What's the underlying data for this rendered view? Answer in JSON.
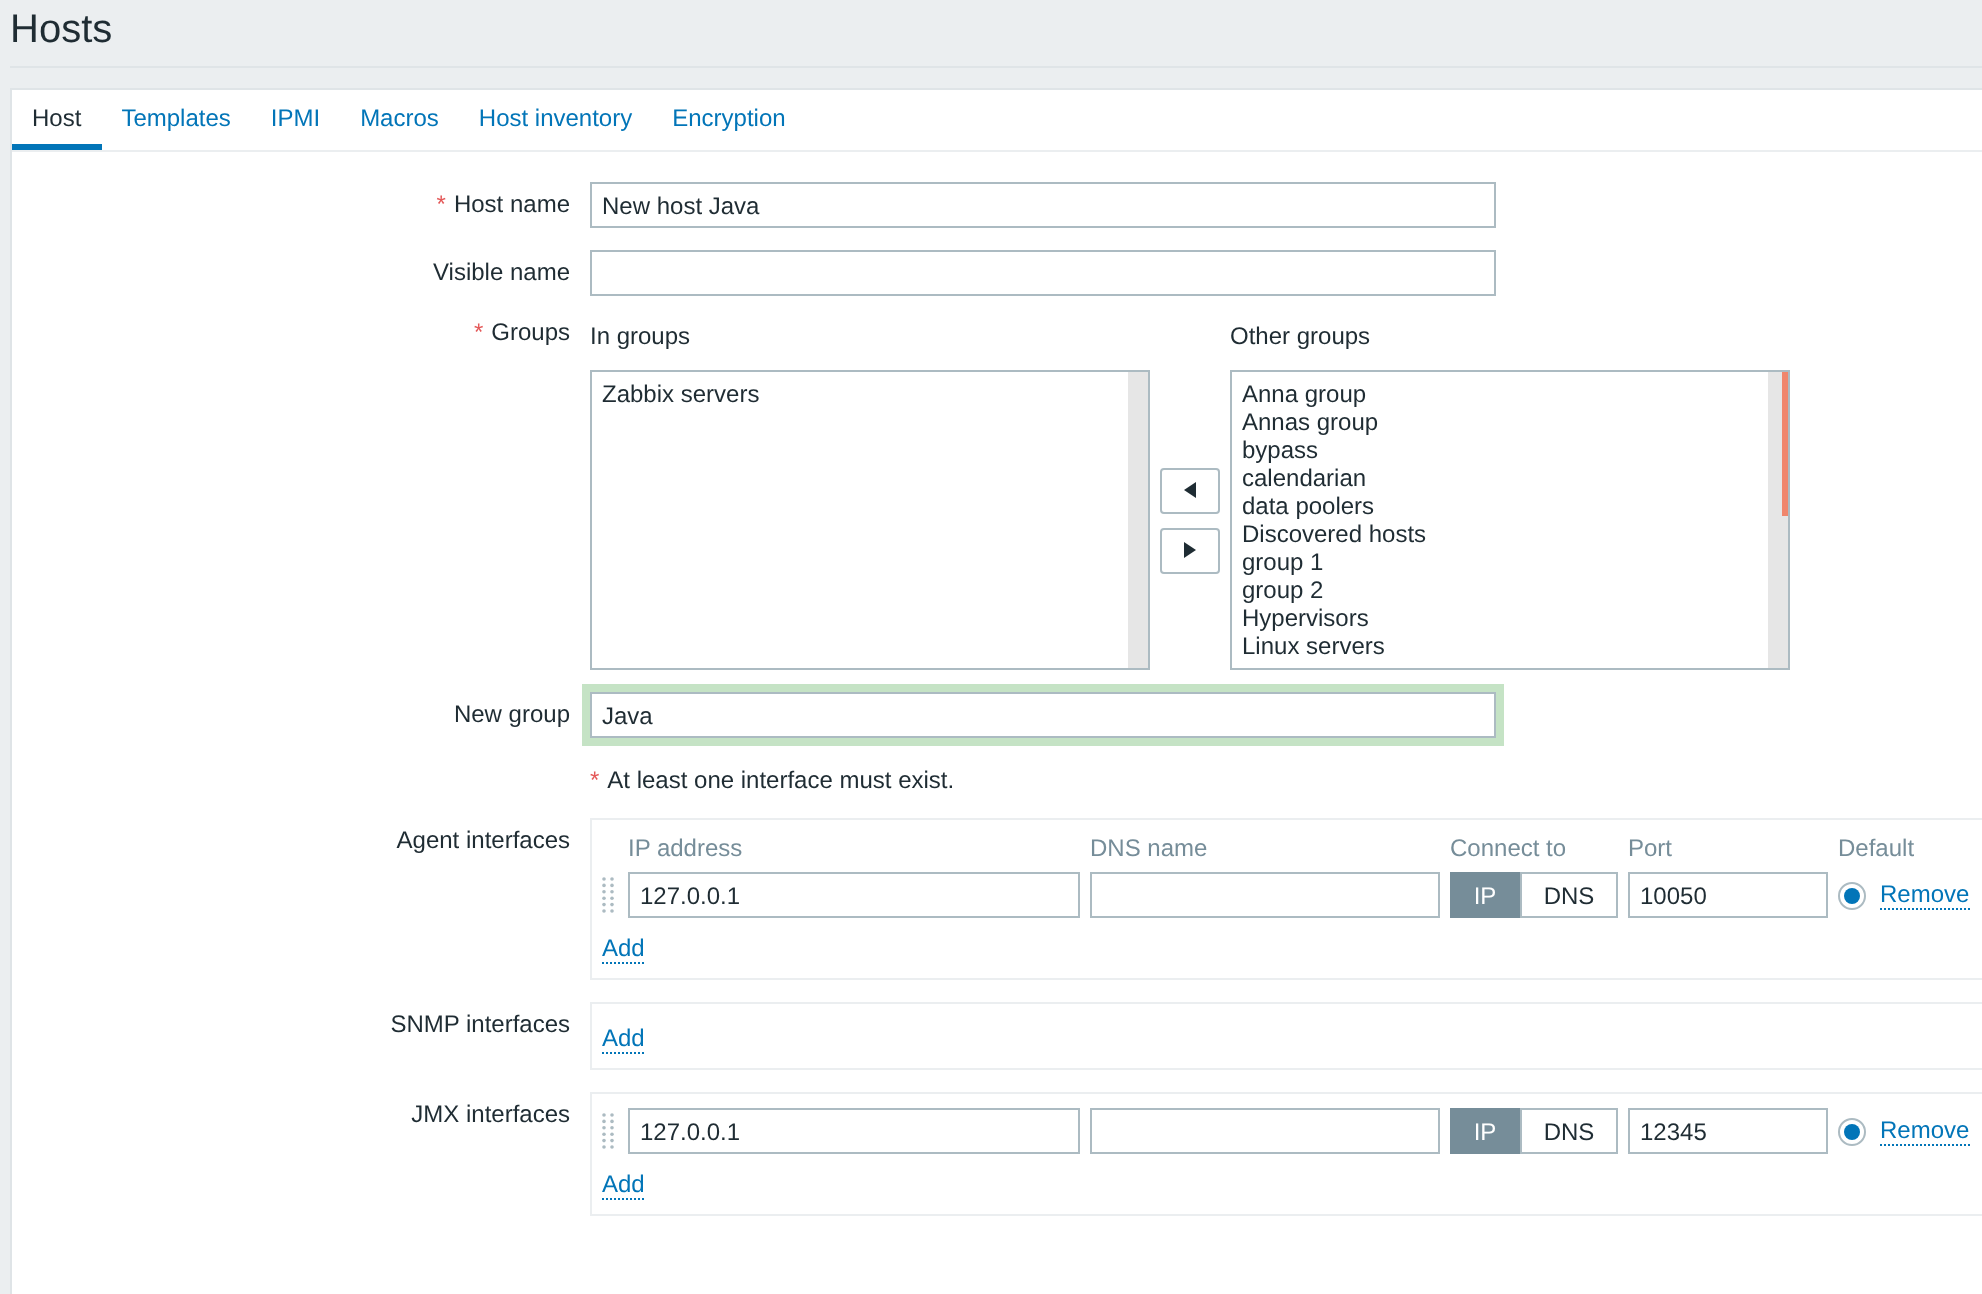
{
  "page_title": "Hosts",
  "tabs": [
    {
      "label": "Host",
      "selected": true
    },
    {
      "label": "Templates",
      "selected": false
    },
    {
      "label": "IPMI",
      "selected": false
    },
    {
      "label": "Macros",
      "selected": false
    },
    {
      "label": "Host inventory",
      "selected": false
    },
    {
      "label": "Encryption",
      "selected": false
    }
  ],
  "required_mark": "*",
  "host_name": {
    "label": "Host name",
    "required": true,
    "value": "New host Java"
  },
  "visible_name": {
    "label": "Visible name",
    "required": false
  },
  "groups": {
    "label": "Groups",
    "required": true,
    "in_groups": {
      "heading": "In groups",
      "items": [
        "Zabbix servers"
      ]
    },
    "other_groups": {
      "heading": "Other groups",
      "items": [
        "Anna group",
        "Annas group",
        "bypass",
        "calendarian",
        "data poolers",
        "Discovered hosts",
        "group 1",
        "group 2",
        "Hypervisors",
        "Linux servers"
      ]
    }
  },
  "new_group": {
    "label": "New group",
    "value": "Java"
  },
  "interface_note": "At least one interface must exist.",
  "interfaces": [
    {
      "label": "Agent interfaces",
      "columns": [
        "IP address",
        "DNS name",
        "Connect to",
        "Port",
        "Default"
      ],
      "rows": [
        {
          "ip": "127.0.0.1",
          "connect": [
            {
              "label": "IP",
              "selected": true
            },
            {
              "label": "DNS",
              "selected": false
            }
          ],
          "port": "10050",
          "default": true,
          "remove": "Remove"
        }
      ],
      "add": "Add"
    },
    {
      "label": "SNMP interfaces",
      "add": "Add"
    },
    {
      "label": "JMX interfaces",
      "rows": [
        {
          "ip": "127.0.0.1",
          "connect": [
            {
              "label": "IP",
              "selected": true
            },
            {
              "label": "DNS",
              "selected": false
            }
          ],
          "port": "12345",
          "default": true,
          "remove": "Remove"
        }
      ],
      "add": "Add"
    }
  ]
}
